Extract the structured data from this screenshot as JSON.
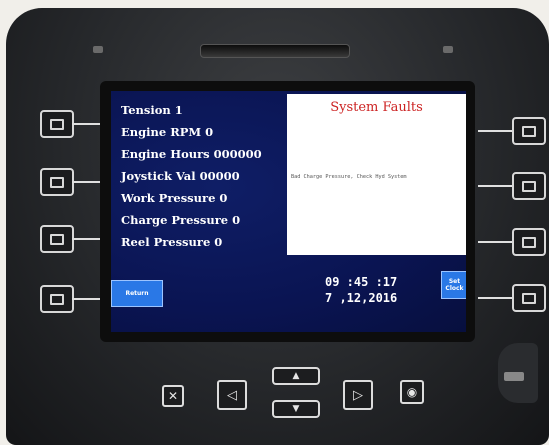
{
  "readouts": [
    "Tension 1",
    "Engine RPM 0",
    "Engine Hours 000000",
    "Joystick Val 00000",
    "Work Pressure 0",
    "Charge Pressure 0",
    "Reel Pressure  0"
  ],
  "faults": {
    "title": "System Faults",
    "message": "Bad Charge Pressure, Check Hyd System"
  },
  "buttons": {
    "return_label": "Return",
    "set_clock_label": "Set Clock"
  },
  "clock": {
    "time": "09 :45 :17",
    "date": "7 ,12,2016"
  },
  "icons": {
    "nav_close": "close-icon",
    "nav_left": "left-arrow-icon",
    "nav_up": "up-arrow-icon",
    "nav_down": "down-arrow-icon",
    "nav_right": "right-arrow-icon",
    "nav_ok": "ok-icon"
  },
  "colors": {
    "screen_bg": "#0a1452",
    "button_blue": "#2a78e6",
    "fault_title": "#cc2222"
  }
}
